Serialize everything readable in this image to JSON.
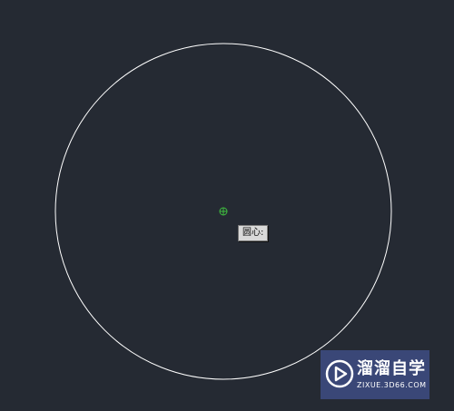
{
  "snap_tooltip": {
    "label": "圆心:"
  },
  "watermark": {
    "title": "溜溜自学",
    "url": "ZIXUE.3D66.COM",
    "icon": "play-logo-icon"
  },
  "colors": {
    "background": "#252a33",
    "circle_stroke": "#ffffff",
    "center_marker": "#3fbf3f",
    "watermark_bg": "#3c4a7d"
  }
}
